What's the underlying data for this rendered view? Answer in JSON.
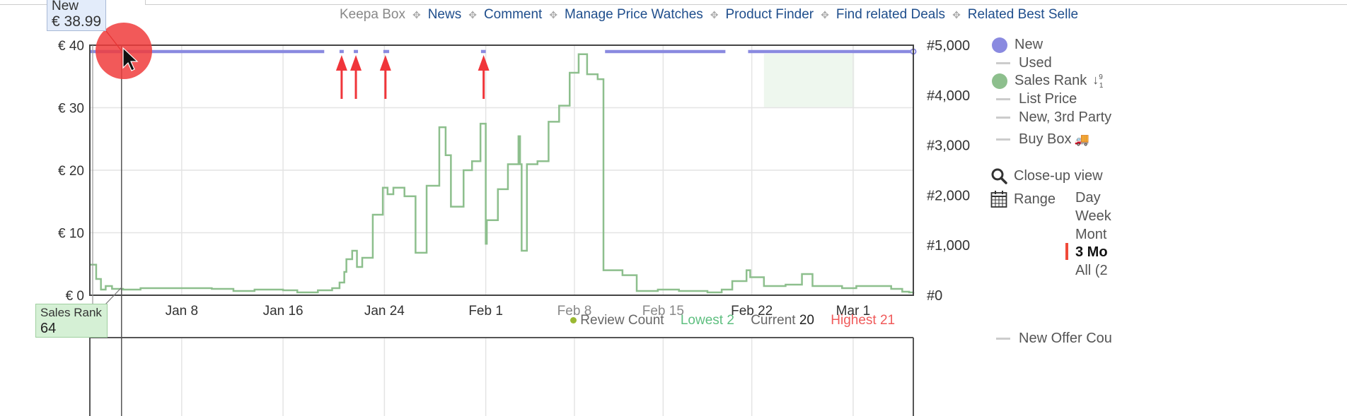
{
  "tooltip_new": {
    "label": "New",
    "value": "€ 38.99"
  },
  "tooltip_rank": {
    "label": "Sales Rank",
    "value": "64"
  },
  "links": [
    {
      "label": "Keepa Box",
      "muted": true
    },
    {
      "label": "News"
    },
    {
      "label": "Comment"
    },
    {
      "label": "Manage Price Watches"
    },
    {
      "label": "Product Finder"
    },
    {
      "label": "Find related Deals"
    },
    {
      "label": "Related Best Selle"
    }
  ],
  "legend": {
    "items": [
      "New",
      "Used",
      "Sales Rank",
      "List Price",
      "New, 3rd Party",
      "Buy Box"
    ],
    "sort_icon": "sort-numeric-icon",
    "truck_icon": "🚚",
    "closeup": "Close-up view",
    "range_label": "Range",
    "ranges": [
      "Day",
      "Week",
      "Mont",
      "3 Mo",
      "All (2"
    ],
    "active_range": "3 Mo",
    "new_offer_count": "New Offer Cou"
  },
  "bottom_legend": {
    "series": "Review Count",
    "lowest_label": "Lowest",
    "lowest": "2",
    "current_label": "Current",
    "current": "20",
    "highest_label": "Highest",
    "highest": "21"
  },
  "colors": {
    "new": "#8a8ae0",
    "sales_rank": "#8dbf8d",
    "link": "#1f4e8c",
    "highest": "#f05a5a",
    "lowest": "#5fbf80",
    "annotation": "#f0353a"
  },
  "chart_data": {
    "type": "line",
    "x_start": "12-31T18",
    "x_end": "03-05T18",
    "x_ticks": [
      {
        "label": "Jan 8",
        "date": "01-08T00"
      },
      {
        "label": "Jan 16",
        "date": "01-16T00"
      },
      {
        "label": "Jan 24",
        "date": "01-24T00"
      },
      {
        "label": "Feb 1",
        "date": "02-01T00"
      },
      {
        "label": "Feb 8",
        "date": "02-08T00"
      },
      {
        "label": "Feb 15",
        "date": "02-15T00"
      },
      {
        "label": "Feb 22",
        "date": "02-22T00"
      },
      {
        "label": "Mar 1",
        "date": "03-01T00"
      }
    ],
    "y_left": {
      "ticks": [
        "€ 0",
        "€ 10",
        "€ 20",
        "€ 30",
        "€ 40"
      ],
      "values": [
        0,
        10,
        20,
        30,
        40
      ],
      "range": [
        0,
        40
      ]
    },
    "y_right": {
      "ticks": [
        "#0",
        "#1,000",
        "#2,000",
        "#3,000",
        "#4,000",
        "#5,000"
      ],
      "values": [
        0,
        1000,
        2000,
        3000,
        4000,
        5000
      ],
      "range": [
        0,
        5000
      ]
    },
    "grid": true,
    "series": [
      {
        "name": "New",
        "axis": "left",
        "style": "step",
        "segments": [
          {
            "from": "12-31T18",
            "to": "01-19T06",
            "value": 38.99
          },
          {
            "from": "01-20T11",
            "to": "01-20T19",
            "value": 38.99
          },
          {
            "from": "01-21T14",
            "to": "01-21T22",
            "value": 38.99
          },
          {
            "from": "01-23T22",
            "to": "01-24T09",
            "value": 38.99
          },
          {
            "from": "01-31T15",
            "to": "02-01T00",
            "value": 38.99
          },
          {
            "from": "02-10T10",
            "to": "02-19T22",
            "value": 38.99
          },
          {
            "from": "02-21T17",
            "to": "03-05T18",
            "value": 38.99
          }
        ]
      },
      {
        "name": "Sales Rank",
        "axis": "right",
        "style": "step",
        "points": [
          [
            "12-31T18",
            610
          ],
          [
            "01-01T06",
            325
          ],
          [
            "01-01T15",
            113
          ],
          [
            "01-02T00",
            184
          ],
          [
            "01-02T12",
            127
          ],
          [
            "01-03T09",
            113
          ],
          [
            "01-04T18",
            141
          ],
          [
            "01-10T09",
            127
          ],
          [
            "01-12T02",
            85
          ],
          [
            "01-13T18",
            113
          ],
          [
            "01-16T00",
            99
          ],
          [
            "01-17T03",
            56
          ],
          [
            "01-18T18",
            99
          ],
          [
            "01-19T21",
            141
          ],
          [
            "01-20T11",
            254
          ],
          [
            "01-20T20",
            466
          ],
          [
            "01-21T00",
            720
          ],
          [
            "01-21T11",
            890
          ],
          [
            "01-21T20",
            565
          ],
          [
            "01-22T06",
            749
          ],
          [
            "01-23T02",
            1610
          ],
          [
            "01-23T21",
            2150
          ],
          [
            "01-24T06",
            2020
          ],
          [
            "01-24T17",
            2150
          ],
          [
            "01-25T14",
            1980
          ],
          [
            "01-26T11",
            850
          ],
          [
            "01-27T08",
            2190
          ],
          [
            "01-28T08",
            3360
          ],
          [
            "01-28T20",
            2800
          ],
          [
            "01-29T06",
            1770
          ],
          [
            "01-30T06",
            2500
          ],
          [
            "01-30T22",
            2680
          ],
          [
            "01-31T14",
            3430
          ],
          [
            "02-01T00",
            1030
          ],
          [
            "02-01T02",
            1500
          ],
          [
            "02-01T23",
            2120
          ],
          [
            "02-02T18",
            2620
          ],
          [
            "02-03T14",
            3180
          ],
          [
            "02-03T17",
            2620
          ],
          [
            "02-03T20",
            890
          ],
          [
            "02-04T06",
            2620
          ],
          [
            "02-05T02",
            2680
          ],
          [
            "02-05T23",
            3470
          ],
          [
            "02-06T19",
            3790
          ],
          [
            "02-07T15",
            4450
          ],
          [
            "02-08T08",
            4820
          ],
          [
            "02-09T00",
            4420
          ],
          [
            "02-09T20",
            4320
          ],
          [
            "02-10T07",
            500
          ],
          [
            "02-11T19",
            400
          ],
          [
            "02-12T22",
            85
          ],
          [
            "02-14T14",
            113
          ],
          [
            "02-16T06",
            85
          ],
          [
            "02-18T12",
            56
          ],
          [
            "02-19T15",
            113
          ],
          [
            "02-20T11",
            282
          ],
          [
            "02-21T14",
            500
          ],
          [
            "02-21T21",
            360
          ],
          [
            "02-22T23",
            184
          ],
          [
            "02-24T16",
            212
          ],
          [
            "02-25T23",
            424
          ],
          [
            "02-26T19",
            184
          ],
          [
            "02-29T03",
            141
          ],
          [
            "03-01T06",
            184
          ],
          [
            "03-04T00",
            127
          ],
          [
            "03-04T21",
            70
          ],
          [
            "03-05T10",
            56
          ],
          [
            "03-05T18",
            64
          ]
        ]
      }
    ],
    "highlight_range": {
      "from": "02-22T23",
      "to": "03-01T02"
    },
    "annotation_arrows": [
      "01-20T15",
      "01-21T18",
      "01-24T02",
      "01-31T20"
    ],
    "hover_date": "01-03T06"
  }
}
